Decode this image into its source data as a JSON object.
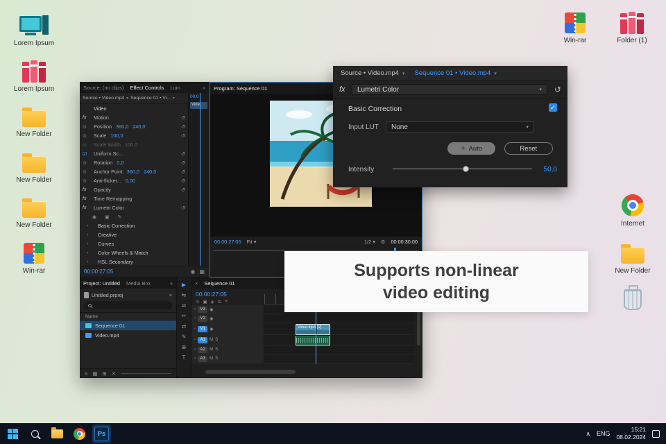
{
  "icons": {
    "chevron_down": "▾",
    "reset": "↺",
    "menu": "≡",
    "overflow": "»",
    "close": "×",
    "plus": "+",
    "check": "✓",
    "caret_up": "∧",
    "lock": "▫",
    "fx": "fx",
    "wrench": "⚙"
  },
  "desktop": {
    "left_icons": [
      {
        "label": "Lorem Ipsum",
        "cls": "icon-computer",
        "name": "computer-icon"
      },
      {
        "label": "Lorem Ipsum",
        "cls": "icon-binders",
        "name": "binders-icon"
      },
      {
        "label": "New Folder",
        "cls": "icon-folder",
        "name": "folder-icon"
      },
      {
        "label": "New Folder",
        "cls": "icon-folder",
        "name": "folder-icon"
      },
      {
        "label": "New Folder",
        "cls": "icon-folder",
        "name": "folder-icon"
      },
      {
        "label": "Win-rar",
        "cls": "icon-winrar",
        "name": "winrar-icon"
      }
    ],
    "top_right_icons": [
      {
        "label": "Win-rar",
        "cls": "icon-winrar",
        "name": "winrar-icon"
      },
      {
        "label": "Folder (1)",
        "cls": "icon-binders",
        "name": "archive-folder-icon"
      }
    ],
    "right_icons": [
      {
        "label": "Internet",
        "cls": "icon-chrome",
        "name": "chrome-icon"
      },
      {
        "label": "New Folder",
        "cls": "icon-folder",
        "name": "folder-icon"
      },
      {
        "label": "",
        "cls": "icon-trash",
        "name": "trash-icon"
      }
    ]
  },
  "caption": {
    "line1": "Supports non-linear",
    "line2": "video editing"
  },
  "premiere": {
    "effect_controls": {
      "tabs": [
        {
          "label": "Source: (no clips)",
          "cls": ""
        },
        {
          "label": "Effect Controls",
          "cls": "active"
        },
        {
          "label": "Lum",
          "cls": ""
        }
      ],
      "source_label": "Source • Video.mp4",
      "sequence_label": "Sequence 01 • Vi...",
      "lane_timecode": "00:0",
      "lane_clip": "Vide",
      "rows": [
        {
          "cls": "section",
          "icon": "",
          "label": "Video",
          "v1": "",
          "v2": "",
          "reset": ""
        },
        {
          "cls": "fx",
          "icon": "fx",
          "label": "Motion",
          "v1": "",
          "v2": "",
          "reset": "↺"
        },
        {
          "cls": "param",
          "icon": "⊙",
          "label": "Position",
          "v1": "360,0",
          "v2": "240,0",
          "reset": "↺"
        },
        {
          "cls": "param",
          "icon": "⊙",
          "label": "Scale",
          "v1": "100,0",
          "v2": "",
          "reset": "↺"
        },
        {
          "cls": "param disabled",
          "icon": "⊙",
          "label": "Scale Width",
          "v1": "100,0",
          "v2": "",
          "reset": ""
        },
        {
          "cls": "check",
          "icon": "☑",
          "label": "Uniform Sc...",
          "v1": "",
          "v2": "",
          "reset": "↺"
        },
        {
          "cls": "param",
          "icon": "⊙",
          "label": "Rotation",
          "v1": "0,0",
          "v2": "",
          "reset": "↺"
        },
        {
          "cls": "param",
          "icon": "⊙",
          "label": "Anchor Point",
          "v1": "360,0",
          "v2": "240,0",
          "reset": "↺"
        },
        {
          "cls": "param",
          "icon": "⊙",
          "label": "Anti-flicker...",
          "v1": "0,00",
          "v2": "",
          "reset": "↺"
        },
        {
          "cls": "fx",
          "icon": "fx",
          "label": "Opacity",
          "v1": "",
          "v2": "",
          "reset": "↺"
        },
        {
          "cls": "fx",
          "icon": "fx",
          "label": "Time Remapping",
          "v1": "",
          "v2": "",
          "reset": ""
        },
        {
          "cls": "fx",
          "icon": "fx",
          "label": "Lumetri Color",
          "v1": "",
          "v2": "",
          "reset": "↺"
        },
        {
          "cls": "masktools",
          "icon": "◉ ▣ ✎",
          "label": "",
          "v1": "",
          "v2": "",
          "reset": ""
        },
        {
          "cls": "group",
          "icon": "›",
          "label": "Basic Correction",
          "v1": "",
          "v2": "",
          "reset": ""
        },
        {
          "cls": "group",
          "icon": "›",
          "label": "Creative",
          "v1": "",
          "v2": "",
          "reset": ""
        },
        {
          "cls": "group",
          "icon": "›",
          "label": "Curves",
          "v1": "",
          "v2": "",
          "reset": ""
        },
        {
          "cls": "group",
          "icon": "›",
          "label": "Color Wheels & Match",
          "v1": "",
          "v2": "",
          "reset": ""
        },
        {
          "cls": "group",
          "icon": "›",
          "label": "HSL Secondary",
          "v1": "",
          "v2": "",
          "reset": ""
        }
      ],
      "timecode": "00:00:27:05",
      "foot_icons": [
        {
          "glyph": "◉",
          "name": "show-keyframes-icon"
        },
        {
          "glyph": "▦",
          "name": "panel-options-icon"
        }
      ]
    },
    "program": {
      "tab": "Program: Sequence 01",
      "timecode": "00:00:27:05",
      "fit_label": "Fit",
      "zoom_label": "1/2",
      "duration": "00:00:30:00",
      "transport": [
        {
          "glyph": "{",
          "name": "mark-in-icon"
        },
        {
          "glyph": "}",
          "name": "mark-out-icon"
        },
        {
          "glyph": "⇤",
          "name": "go-to-in-icon"
        },
        {
          "glyph": "◀",
          "name": "step-back-icon"
        },
        {
          "glyph": "▶",
          "name": "play-icon"
        },
        {
          "glyph": "⇥",
          "name": "step-forward-icon"
        }
      ]
    },
    "project": {
      "tabs": [
        {
          "label": "Project: Untitled",
          "cls": "active"
        },
        {
          "label": "Media Bro",
          "cls": ""
        }
      ],
      "file_label": "Untitled.prproj",
      "name_header": "Name",
      "items": [
        {
          "label": "Sequence 01",
          "cls": "selected",
          "ic": "seq",
          "name": "sequence-item"
        },
        {
          "label": "Video.mp4",
          "cls": "",
          "ic": "vid",
          "name": "video-item"
        }
      ],
      "footer_icons": [
        {
          "glyph": "≡",
          "name": "list-view-icon"
        },
        {
          "glyph": "▦",
          "name": "icon-view-icon"
        },
        {
          "glyph": "⊞",
          "name": "new-bin-icon"
        },
        {
          "glyph": "✕",
          "name": "delete-icon"
        }
      ]
    },
    "tools": [
      {
        "glyph": "▶",
        "name": "selection-tool",
        "cls": "active"
      },
      {
        "glyph": "⇆",
        "name": "track-select-tool",
        "cls": ""
      },
      {
        "glyph": "⇌",
        "name": "ripple-edit-tool",
        "cls": ""
      },
      {
        "glyph": "✂",
        "name": "razor-tool",
        "cls": ""
      },
      {
        "glyph": "⇄",
        "name": "slip-tool",
        "cls": ""
      },
      {
        "glyph": "✎",
        "name": "pen-tool",
        "cls": ""
      },
      {
        "glyph": "⊕",
        "name": "hand-tool",
        "cls": ""
      },
      {
        "glyph": "T",
        "name": "type-tool",
        "cls": ""
      }
    ],
    "timeline": {
      "tab": "Sequence 01",
      "timecode": "00:00:27:05",
      "toolbar_icons": [
        {
          "glyph": "⊙",
          "name": "snap-icon"
        },
        {
          "glyph": "▣",
          "name": "linked-selection-icon"
        },
        {
          "glyph": "◈",
          "name": "add-marker-icon"
        },
        {
          "glyph": "⊡",
          "name": "timeline-settings-icon"
        },
        {
          "glyph": "≡",
          "name": "timeline-menu-icon"
        }
      ],
      "tracks": [
        {
          "name": "V3",
          "cls": "r13",
          "badge": "",
          "t1": "◉",
          "t2": ""
        },
        {
          "name": "V2",
          "cls": "r13",
          "badge": "",
          "t1": "◉",
          "t2": ""
        },
        {
          "name": "V1",
          "cls": "r17",
          "badge": "active",
          "t1": "◉",
          "t2": ""
        },
        {
          "name": "A1",
          "cls": "r15",
          "badge": "active",
          "t1": "M",
          "t2": "S"
        },
        {
          "name": "A2",
          "cls": "r13",
          "badge": "",
          "t1": "M",
          "t2": "S"
        },
        {
          "name": "A3",
          "cls": "r13",
          "badge": "",
          "t1": "M",
          "t2": "S"
        }
      ],
      "clip_label": "Video.mp4 [V]"
    }
  },
  "lumetri": {
    "source_tab": "Source • Video.mp4",
    "sequence_tab": "Sequence 01 • Video.mp4",
    "effect_select": "Lumetri Color",
    "section": "Basic Correction",
    "input_lut_label": "Input LUT",
    "input_lut_value": "None",
    "auto_icon": "✧",
    "auto_label": "Auto",
    "reset_label": "Reset",
    "intensity_label": "Intensity",
    "intensity_value": "50,0"
  },
  "taskbar": {
    "ps_label": "Ps",
    "lang": "ENG",
    "time": "15:21",
    "date": "08.02.2024"
  }
}
